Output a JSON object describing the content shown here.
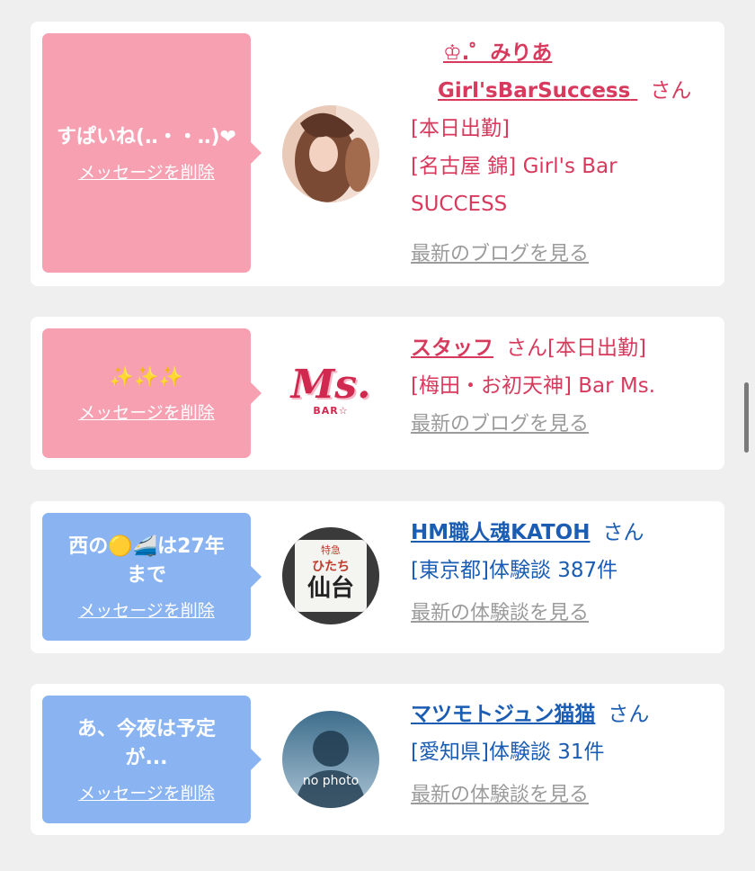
{
  "cards": [
    {
      "message": "すぱいね(‥・・‥)❤",
      "delete_label": "メッセージを削除",
      "name_line1": "♔.゜みりあ",
      "name_line2": "Girl'sBarSuccess",
      "honorific": "さん",
      "status": "[本日出勤]",
      "location": "[名古屋 錦] Girl's Bar SUCCESS",
      "link": "最新のブログを見る",
      "theme": "pink"
    },
    {
      "message": "✨✨✨",
      "delete_label": "メッセージを削除",
      "name": "スタッフ",
      "honorific": "さん",
      "status": "[本日出勤]",
      "location": "[梅田・お初天神] Bar Ms.",
      "logo_text": "Ms.",
      "logo_sub": "BAR☆",
      "link": "最新のブログを見る",
      "theme": "pink"
    },
    {
      "message": "西の🟡🚄は27年\nまで",
      "delete_label": "メッセージを削除",
      "name": "HM職人魂KATOH",
      "honorific": "さん",
      "location": "[東京都]体験談 387件",
      "avatar_top": "特急",
      "avatar_mid": "ひたち",
      "avatar_city": "仙台",
      "link": "最新の体験談を見る",
      "theme": "blue"
    },
    {
      "message": "あ、今夜は予定\nが...",
      "delete_label": "メッセージを削除",
      "name": "マツモトジュン猫猫",
      "honorific": "さん",
      "location": "[愛知県]体験談 31件",
      "avatar_text": "no photo",
      "link": "最新の体験談を見る",
      "theme": "blue"
    }
  ],
  "colors": {
    "pink_bubble": "#f6a0b2",
    "blue_bubble": "#8ab3f2",
    "pink_text": "#d83a5e",
    "blue_text": "#1c5db4",
    "link_gray": "#9b9b9b",
    "background": "#efeff0"
  }
}
